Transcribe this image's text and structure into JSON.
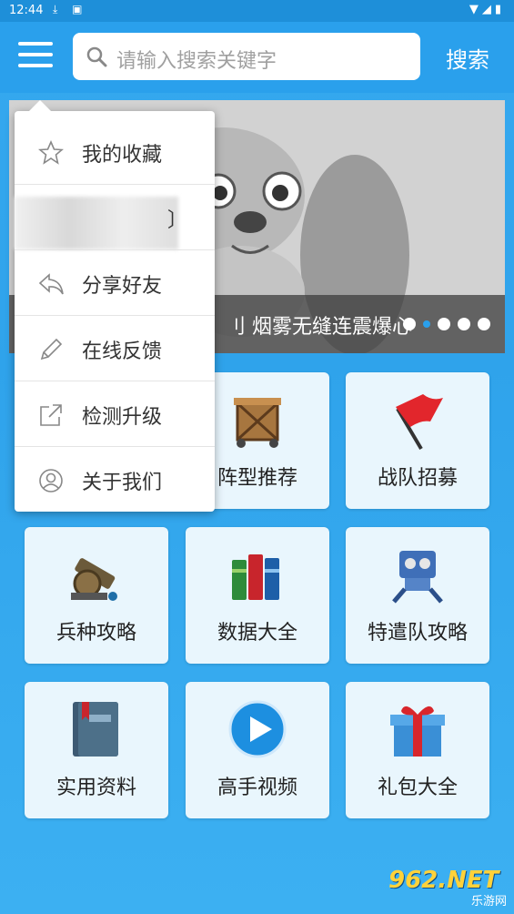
{
  "status_bar": {
    "time": "12:44"
  },
  "header": {
    "search_placeholder": "请输入搜索关键字",
    "search_button": "搜索"
  },
  "banner": {
    "caption": "刂 烟雾无缝连震爆心",
    "slide_count": 5,
    "active_slide": 1
  },
  "dropdown_menu": {
    "items": [
      {
        "label": "我的收藏",
        "icon": "star-icon"
      },
      {
        "label": "",
        "icon": ""
      },
      {
        "label": "分享好友",
        "icon": "share-icon"
      },
      {
        "label": "在线反馈",
        "icon": "pencil-icon"
      },
      {
        "label": "检测升级",
        "icon": "external-link-icon"
      },
      {
        "label": "关于我们",
        "icon": "user-circle-icon"
      }
    ],
    "blurred_tail": "〕"
  },
  "grid": {
    "tiles": [
      {
        "label": "",
        "icon": ""
      },
      {
        "label": "阵型推荐",
        "icon": "crate-icon"
      },
      {
        "label": "战队招募",
        "icon": "red-flag-icon"
      },
      {
        "label": "兵种攻略",
        "icon": "cannon-icon"
      },
      {
        "label": "数据大全",
        "icon": "books-icon"
      },
      {
        "label": "特遣队攻略",
        "icon": "robot-icon"
      },
      {
        "label": "实用资料",
        "icon": "notebook-icon"
      },
      {
        "label": "高手视频",
        "icon": "play-icon"
      },
      {
        "label": "礼包大全",
        "icon": "gift-icon"
      }
    ]
  },
  "watermark": {
    "brand": "962.NET",
    "sub": "乐游网"
  },
  "colors": {
    "accent": "#2aa0ec",
    "tile_bg": "#e9f6fd",
    "brand_yellow": "#ffd23a"
  }
}
